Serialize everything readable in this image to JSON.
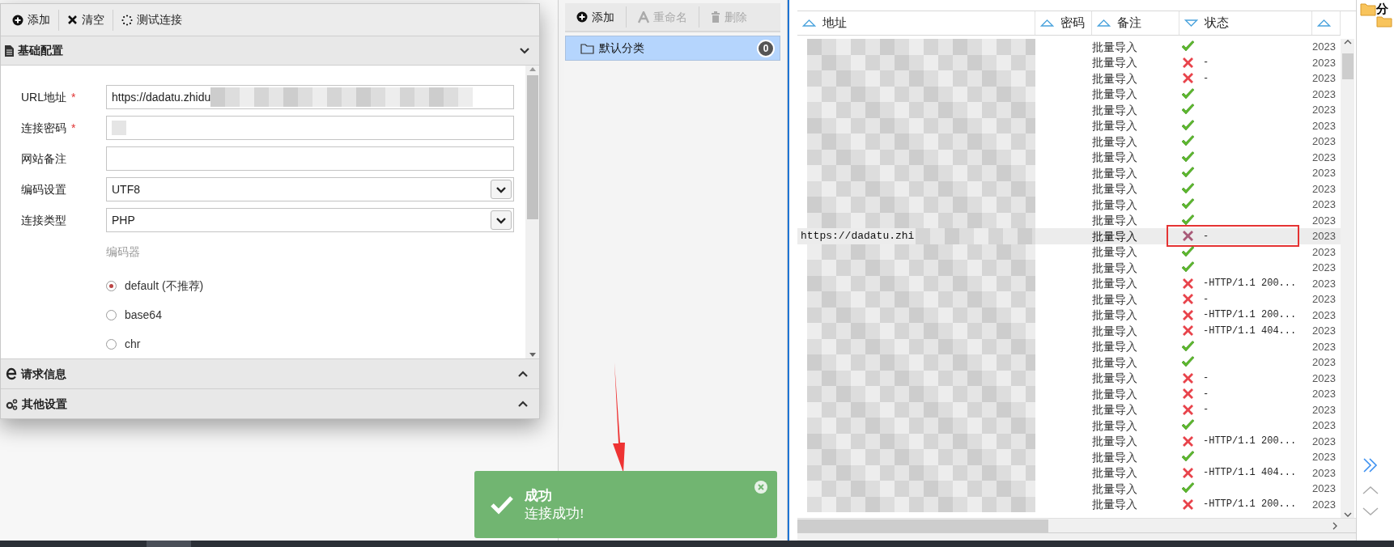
{
  "dialog": {
    "toolbar": [
      {
        "label": "添加",
        "kind": "add"
      },
      {
        "label": "清空",
        "kind": "clear"
      },
      {
        "label": "测试连接",
        "kind": "test"
      }
    ],
    "basic_section": {
      "title": "基础配置",
      "expanded": true
    },
    "fields": [
      {
        "label": "URL地址",
        "required_mark": "*",
        "kind": "text",
        "value": "https://dadatu.zhidu",
        "blurred": true
      },
      {
        "label": "连接密码",
        "required_mark": "*",
        "kind": "text",
        "blurred": true
      },
      {
        "label": "网站备注",
        "kind": "text",
        "blurred": false
      },
      {
        "label": "编码设置",
        "kind": "select",
        "value": "UTF8",
        "blurred": false
      },
      {
        "label": "连接类型",
        "kind": "select",
        "value": "PHP",
        "blurred": false
      }
    ],
    "encoder_label": "编码器",
    "encoders": [
      {
        "label": "default (不推荐)",
        "selected": true
      },
      {
        "label": "base64",
        "selected": false
      },
      {
        "label": "chr",
        "selected": false
      }
    ],
    "other_sections": [
      {
        "title": "请求信息",
        "kind": "request",
        "expanded": false
      },
      {
        "title": "其他设置",
        "kind": "settings",
        "expanded": false
      }
    ]
  },
  "category_panel": {
    "toolbar": [
      {
        "label": "添加",
        "kind": "add",
        "disabled": false
      },
      {
        "label": "重命名",
        "kind": "rename",
        "disabled": true
      },
      {
        "label": "删除",
        "kind": "delete",
        "disabled": true
      }
    ],
    "items": [
      {
        "label": "默认分类",
        "count": "0",
        "selected": true
      }
    ]
  },
  "table": {
    "columns": [
      {
        "label": "地址",
        "sort_descending": false
      },
      {
        "label": "密码",
        "sort_descending": false
      },
      {
        "label": "备注",
        "sort_descending": false
      },
      {
        "label": "状态",
        "sort_descending": true
      },
      {
        "sort_descending": false
      }
    ],
    "rows": [
      {
        "note": "批量导入",
        "failed": false,
        "column_5": "2023",
        "selected": false
      },
      {
        "note": "批量导入",
        "failed": true,
        "message": "-",
        "column_5": "2023",
        "selected": false
      },
      {
        "note": "批量导入",
        "failed": true,
        "message": "-",
        "column_5": "2023",
        "selected": false
      },
      {
        "note": "批量导入",
        "failed": false,
        "column_5": "2023",
        "selected": false
      },
      {
        "note": "批量导入",
        "failed": false,
        "column_5": "2023",
        "selected": false
      },
      {
        "note": "批量导入",
        "failed": false,
        "column_5": "2023",
        "selected": false
      },
      {
        "note": "批量导入",
        "failed": false,
        "column_5": "2023",
        "selected": false
      },
      {
        "note": "批量导入",
        "failed": false,
        "column_5": "2023",
        "selected": false
      },
      {
        "note": "批量导入",
        "failed": false,
        "column_5": "2023",
        "selected": false
      },
      {
        "note": "批量导入",
        "failed": false,
        "column_5": "2023",
        "selected": false
      },
      {
        "note": "批量导入",
        "failed": false,
        "column_5": "2023",
        "selected": false
      },
      {
        "note": "批量导入",
        "failed": false,
        "column_5": "2023",
        "selected": false
      },
      {
        "address": "https://dadatu.zhi",
        "note": "批量导入",
        "failed": true,
        "message": "-",
        "column_5": "2023",
        "selected": true
      },
      {
        "note": "批量导入",
        "failed": false,
        "column_5": "2023",
        "selected": false
      },
      {
        "note": "批量导入",
        "failed": false,
        "column_5": "2023",
        "selected": false
      },
      {
        "note": "批量导入",
        "failed": true,
        "message": "-HTTP/1.1 200...",
        "column_5": "2023",
        "selected": false
      },
      {
        "note": "批量导入",
        "failed": true,
        "message": "-",
        "column_5": "2023",
        "selected": false
      },
      {
        "note": "批量导入",
        "failed": true,
        "message": "-HTTP/1.1 200...",
        "column_5": "2023",
        "selected": false
      },
      {
        "note": "批量导入",
        "failed": true,
        "message": "-HTTP/1.1 404...",
        "column_5": "2023",
        "selected": false
      },
      {
        "note": "批量导入",
        "failed": false,
        "column_5": "2023",
        "selected": false
      },
      {
        "note": "批量导入",
        "failed": false,
        "column_5": "2023",
        "selected": false
      },
      {
        "note": "批量导入",
        "failed": true,
        "message": "-",
        "column_5": "2023",
        "selected": false
      },
      {
        "note": "批量导入",
        "failed": true,
        "message": "-",
        "column_5": "2023",
        "selected": false
      },
      {
        "note": "批量导入",
        "failed": true,
        "message": "-",
        "column_5": "2023",
        "selected": false
      },
      {
        "note": "批量导入",
        "failed": false,
        "column_5": "2023",
        "selected": false
      },
      {
        "note": "批量导入",
        "failed": true,
        "message": "-HTTP/1.1 200...",
        "column_5": "2023",
        "selected": false
      },
      {
        "note": "批量导入",
        "failed": false,
        "column_5": "2023",
        "selected": false
      },
      {
        "note": "批量导入",
        "failed": true,
        "message": "-HTTP/1.1 404...",
        "column_5": "2023",
        "selected": false
      },
      {
        "note": "批量导入",
        "failed": false,
        "column_5": "2023",
        "selected": false
      },
      {
        "note": "批量导入",
        "failed": true,
        "message": "-HTTP/1.1 200...",
        "column_5": "2023",
        "selected": false
      }
    ]
  },
  "side_panel": {
    "label": "分"
  },
  "toast": {
    "title": "成功",
    "message": "连接成功!"
  }
}
